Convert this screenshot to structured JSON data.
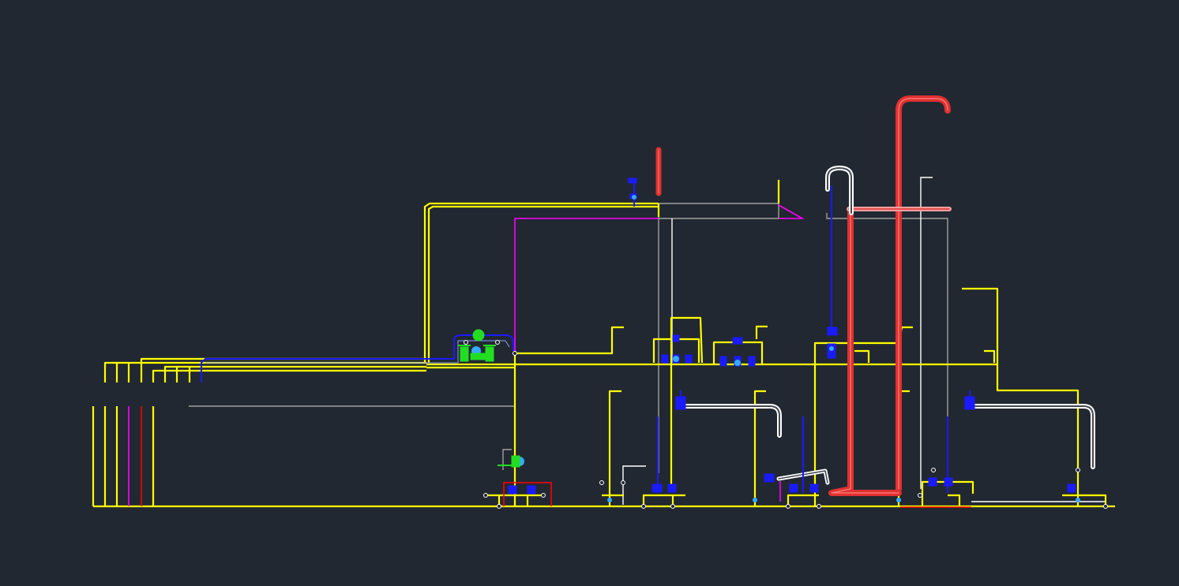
{
  "viewport": {
    "background": "#222831"
  },
  "colors": {
    "yellow": "#ffff00",
    "magenta": "#ff00ff",
    "red": "#ff0000",
    "pipe_red": "#e03030",
    "blue": "#1a1aff",
    "cyan": "#33aaff",
    "white": "#ffffff",
    "gray": "#a0a0a0",
    "green": "#22dd22"
  },
  "legend": [],
  "components": [
    {
      "name": "main-header-pipe",
      "color": "yellow"
    },
    {
      "name": "upper-loop-pipe",
      "color": "yellow"
    },
    {
      "name": "magenta-line",
      "color": "magenta"
    },
    {
      "name": "blue-transfer-pipe",
      "color": "blue"
    },
    {
      "name": "green-control-valve-group",
      "color": "green"
    },
    {
      "name": "red-riser-small",
      "color": "pipe_red"
    },
    {
      "name": "red-riser-tall",
      "color": "pipe_red"
    },
    {
      "name": "red-riser-mid",
      "color": "pipe_red"
    },
    {
      "name": "white-goose-neck",
      "color": "white"
    },
    {
      "name": "gray-outline-frame",
      "color": "gray"
    },
    {
      "name": "bottom-pump-stations",
      "color": "yellow"
    }
  ]
}
